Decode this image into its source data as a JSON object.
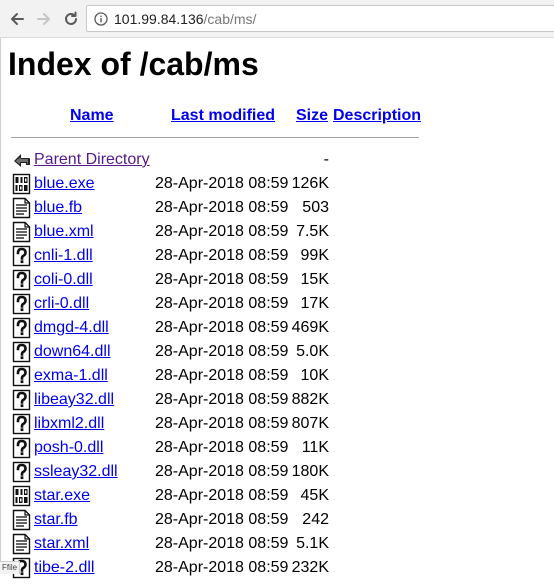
{
  "browser": {
    "url_host": "101.99.84.136",
    "url_path": "/cab/ms/"
  },
  "page": {
    "title": "Index of /cab/ms"
  },
  "columns": {
    "name": "Name",
    "last_modified": "Last modified",
    "size": "Size",
    "description": "Description"
  },
  "rows": [
    {
      "icon": "back-arrow-icon",
      "name": "Parent Directory",
      "date": "",
      "size": "-",
      "visited": true
    },
    {
      "icon": "binary-file-icon",
      "name": "blue.exe",
      "date": "28-Apr-2018 08:59",
      "size": "126K"
    },
    {
      "icon": "text-file-icon",
      "name": "blue.fb",
      "date": "28-Apr-2018 08:59",
      "size": "503"
    },
    {
      "icon": "text-file-icon",
      "name": "blue.xml",
      "date": "28-Apr-2018 08:59",
      "size": "7.5K"
    },
    {
      "icon": "unknown-file-icon",
      "name": "cnli-1.dll",
      "date": "28-Apr-2018 08:59",
      "size": "99K"
    },
    {
      "icon": "unknown-file-icon",
      "name": "coli-0.dll",
      "date": "28-Apr-2018 08:59",
      "size": "15K"
    },
    {
      "icon": "unknown-file-icon",
      "name": "crli-0.dll",
      "date": "28-Apr-2018 08:59",
      "size": "17K"
    },
    {
      "icon": "unknown-file-icon",
      "name": "dmgd-4.dll",
      "date": "28-Apr-2018 08:59",
      "size": "469K"
    },
    {
      "icon": "unknown-file-icon",
      "name": "down64.dll",
      "date": "28-Apr-2018 08:59",
      "size": "5.0K"
    },
    {
      "icon": "unknown-file-icon",
      "name": "exma-1.dll",
      "date": "28-Apr-2018 08:59",
      "size": "10K"
    },
    {
      "icon": "unknown-file-icon",
      "name": "libeay32.dll",
      "date": "28-Apr-2018 08:59",
      "size": "882K"
    },
    {
      "icon": "unknown-file-icon",
      "name": "libxml2.dll",
      "date": "28-Apr-2018 08:59",
      "size": "807K"
    },
    {
      "icon": "unknown-file-icon",
      "name": "posh-0.dll",
      "date": "28-Apr-2018 08:59",
      "size": "11K"
    },
    {
      "icon": "unknown-file-icon",
      "name": "ssleay32.dll",
      "date": "28-Apr-2018 08:59",
      "size": "180K"
    },
    {
      "icon": "binary-file-icon",
      "name": "star.exe",
      "date": "28-Apr-2018 08:59",
      "size": "45K"
    },
    {
      "icon": "text-file-icon",
      "name": "star.fb",
      "date": "28-Apr-2018 08:59",
      "size": "242"
    },
    {
      "icon": "text-file-icon",
      "name": "star.xml",
      "date": "28-Apr-2018 08:59",
      "size": "5.1K"
    },
    {
      "icon": "unknown-file-icon",
      "name": "tibe-2.dll",
      "date": "28-Apr-2018 08:59",
      "size": "232K"
    }
  ],
  "status_bar": {
    "text": "Ffile"
  }
}
